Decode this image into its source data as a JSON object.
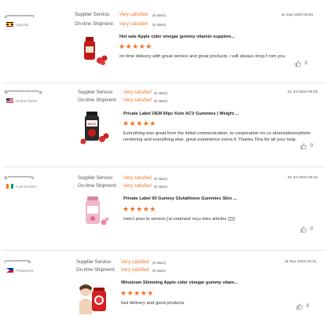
{
  "reviews": [
    {
      "buyer": "s**************l",
      "country": "Uganda",
      "supplier_label": "Supplier Service:",
      "supplier_rating": "Very satisfied",
      "supplier_stars": "(5 stars)",
      "shipment_label": "On-time Shipment:",
      "shipment_rating": "Very satisfied",
      "shipment_stars": "(5 stars)",
      "date": "11 Sep 2023 05:04",
      "product_title": "Hot sale Apple cider vinegar gummy vitamin supplem...",
      "stars": "★★★★★",
      "rating_value": 5,
      "comment": "on time delivery with great service and great products. i will always shop f rom you",
      "likes": "0",
      "product_color": "#c21b1b"
    },
    {
      "buyer": "R*****************a",
      "country": "United States",
      "supplier_label": "Supplier Service:",
      "supplier_rating": "Very satisfied",
      "supplier_stars": "(5 stars)",
      "shipment_label": "On-time Shipment:",
      "shipment_rating": "Very satisfied",
      "shipment_stars": "(5 stars)",
      "date": "21 Jul 2023 09:02",
      "product_title": "Private Label OEM 60pc Keto ACV Gummies | Weight ...",
      "stars": "★★★★★",
      "rating_value": 5,
      "comment": "Everything was great from the initial communication, to cooperation on cu stomizations/photo rendering and everything else, great experience overa ll. Thanks Tina for all your help.",
      "likes": "0",
      "product_color": "#2a2a2a"
    },
    {
      "buyer": "E*************o",
      "country": "Cote D'Ivoire",
      "supplier_label": "Supplier Service:",
      "supplier_rating": "Very satisfied",
      "supplier_stars": "(5 stars)",
      "shipment_label": "On-time Shipment:",
      "shipment_rating": "Very satisfied",
      "shipment_stars": "(5 stars)",
      "date": "20 Jul 2023 09:24",
      "product_title": "Private Label 60 Gummy Glutathione Gummies Skin ...",
      "stars": "★★★★★",
      "rating_value": 5,
      "comment": "merci pour le service j'ai vraiment reçu mes articles ▯▯▯",
      "likes": "0",
      "product_color": "#e8a6b6"
    },
    {
      "buyer": "I************h",
      "country": "Philippines",
      "supplier_label": "Supplier Service:",
      "supplier_rating": "Very satisfied",
      "supplier_stars": "(5 stars)",
      "shipment_label": "On-time Shipment:",
      "shipment_rating": "Very satisfied",
      "shipment_stars": "(5 stars)",
      "date": "19 Nov 2023 16:31",
      "product_title": "Winstown Slimming Apple cider vinegar gummy vitam...",
      "stars": "★★★★★",
      "rating_value": 5,
      "comment": "fast delivery and good products",
      "likes": "0",
      "product_color": "#d42020"
    }
  ],
  "colors": {
    "accent": "#f57224",
    "divider": "#e6e6e6"
  }
}
